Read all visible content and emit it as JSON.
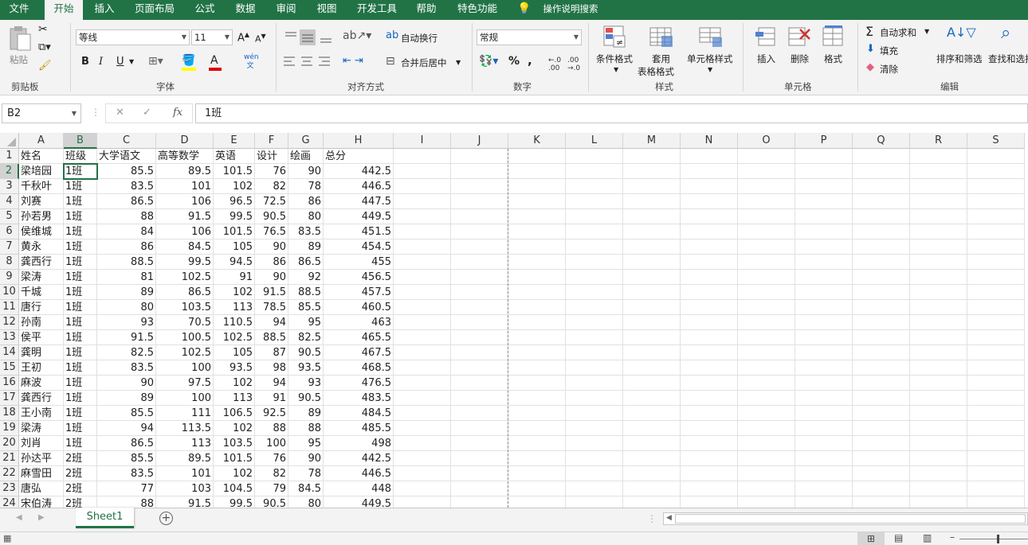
{
  "menu": {
    "tabs": [
      "文件",
      "开始",
      "插入",
      "页面布局",
      "公式",
      "数据",
      "审阅",
      "视图",
      "开发工具",
      "帮助",
      "特色功能"
    ],
    "active": "开始",
    "tell_me": "操作说明搜索"
  },
  "ribbon": {
    "clipboard": {
      "label": "剪贴板",
      "paste": "粘贴"
    },
    "font": {
      "label": "字体",
      "name": "等线",
      "size": "11",
      "bold": "B",
      "italic": "I",
      "underline": "U",
      "wen": "wén 文"
    },
    "alignment": {
      "label": "对齐方式",
      "wrap": "自动换行",
      "merge": "合并后居中"
    },
    "number": {
      "label": "数字",
      "format": "常规",
      "percent": "%",
      "comma": ","
    },
    "styles": {
      "label": "样式",
      "conditional": "条件格式",
      "table1": "套用",
      "table2": "表格格式",
      "cell_styles": "单元格样式"
    },
    "cells": {
      "label": "单元格",
      "insert": "插入",
      "delete": "删除",
      "format": "格式"
    },
    "editing": {
      "label": "编辑",
      "autosum": "自动求和",
      "fill": "填充",
      "clear": "清除",
      "sort": "排序和筛选",
      "find": "查找和选择"
    }
  },
  "formula_bar": {
    "name_box": "B2",
    "fx": "fx",
    "value": "1班"
  },
  "columns": [
    "A",
    "B",
    "C",
    "D",
    "E",
    "F",
    "G",
    "H",
    "I",
    "J",
    "K",
    "L",
    "M",
    "N",
    "O",
    "P",
    "Q",
    "R",
    "S"
  ],
  "header": [
    "姓名",
    "班级",
    "大学语文",
    "高等数学",
    "英语",
    "设计",
    "绘画",
    "总分"
  ],
  "rows": [
    [
      "梁培园",
      "1班",
      "85.5",
      "89.5",
      "101.5",
      "76",
      "90",
      "442.5"
    ],
    [
      "千秋叶",
      "1班",
      "83.5",
      "101",
      "102",
      "82",
      "78",
      "446.5"
    ],
    [
      "刘赛",
      "1班",
      "86.5",
      "106",
      "96.5",
      "72.5",
      "86",
      "447.5"
    ],
    [
      "孙若男",
      "1班",
      "88",
      "91.5",
      "99.5",
      "90.5",
      "80",
      "449.5"
    ],
    [
      "侯维城",
      "1班",
      "84",
      "106",
      "101.5",
      "76.5",
      "83.5",
      "451.5"
    ],
    [
      "黄永",
      "1班",
      "86",
      "84.5",
      "105",
      "90",
      "89",
      "454.5"
    ],
    [
      "龚西行",
      "1班",
      "88.5",
      "99.5",
      "94.5",
      "86",
      "86.5",
      "455"
    ],
    [
      "梁涛",
      "1班",
      "81",
      "102.5",
      "91",
      "90",
      "92",
      "456.5"
    ],
    [
      "千城",
      "1班",
      "89",
      "86.5",
      "102",
      "91.5",
      "88.5",
      "457.5"
    ],
    [
      "唐行",
      "1班",
      "80",
      "103.5",
      "113",
      "78.5",
      "85.5",
      "460.5"
    ],
    [
      "孙南",
      "1班",
      "93",
      "70.5",
      "110.5",
      "94",
      "95",
      "463"
    ],
    [
      "侯平",
      "1班",
      "91.5",
      "100.5",
      "102.5",
      "88.5",
      "82.5",
      "465.5"
    ],
    [
      "龚明",
      "1班",
      "82.5",
      "102.5",
      "105",
      "87",
      "90.5",
      "467.5"
    ],
    [
      "王初",
      "1班",
      "83.5",
      "100",
      "93.5",
      "98",
      "93.5",
      "468.5"
    ],
    [
      "麻波",
      "1班",
      "90",
      "97.5",
      "102",
      "94",
      "93",
      "476.5"
    ],
    [
      "龚西行",
      "1班",
      "89",
      "100",
      "113",
      "91",
      "90.5",
      "483.5"
    ],
    [
      "王小南",
      "1班",
      "85.5",
      "111",
      "106.5",
      "92.5",
      "89",
      "484.5"
    ],
    [
      "梁涛",
      "1班",
      "94",
      "113.5",
      "102",
      "88",
      "88",
      "485.5"
    ],
    [
      "刘肖",
      "1班",
      "86.5",
      "113",
      "103.5",
      "100",
      "95",
      "498"
    ],
    [
      "孙达平",
      "2班",
      "85.5",
      "89.5",
      "101.5",
      "76",
      "90",
      "442.5"
    ],
    [
      "麻雪田",
      "2班",
      "83.5",
      "101",
      "102",
      "82",
      "78",
      "446.5"
    ],
    [
      "唐弘",
      "2班",
      "77",
      "103",
      "104.5",
      "79",
      "84.5",
      "448"
    ],
    [
      "宋伯涛",
      "2班",
      "88",
      "91.5",
      "99.5",
      "90.5",
      "80",
      "449.5"
    ]
  ],
  "sheet_tab": "Sheet1",
  "colors": {
    "accent": "#217346",
    "selection": "#217346"
  }
}
